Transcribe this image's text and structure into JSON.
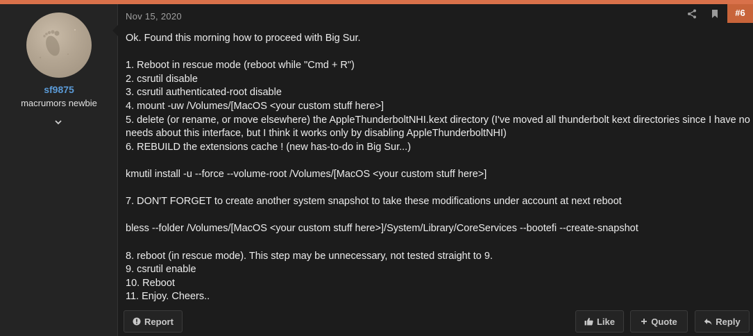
{
  "user": {
    "username": "sf9875",
    "title": "macrumors newbie"
  },
  "post": {
    "date": "Nov 15, 2020",
    "number": "#6",
    "lines": [
      "Ok. Found this morning how to proceed with Big Sur.",
      "",
      "1. Reboot in rescue mode (reboot while \"Cmd + R\")",
      "2. csrutil disable",
      "3. csrutil authenticated-root disable",
      "4. mount -uw /Volumes/[MacOS <your custom stuff here>]",
      "5. delete (or rename, or move elsewhere) the AppleThunderboltNHI.kext directory (I've moved all thunderbolt kext directories since I have no needs about this interface, but I think it works only by disabling AppleThunderboltNHI)",
      "6. REBUILD the extensions cache ! (new has-to-do in Big Sur...)",
      "",
      "kmutil install -u --force --volume-root /Volumes/[MacOS <your custom stuff here>]",
      "",
      "7. DON'T FORGET to create another system snapshot to take these modifications under account at next reboot",
      "",
      "bless --folder /Volumes/[MacOS <your custom stuff here>]/System/Library/CoreServices --bootefi --create-snapshot",
      "",
      "8. reboot (in rescue mode). This step may be unnecessary, not tested straight to 9.",
      "9. csrutil enable",
      "10. Reboot",
      "11. Enjoy. Cheers.."
    ]
  },
  "actions": {
    "report": "Report",
    "like": "Like",
    "quote": "Quote",
    "reply": "Reply"
  },
  "colors": {
    "accent": "#d9714a",
    "username": "#5b9bd8",
    "post_number_bg": "#c8643a"
  },
  "icons": [
    "share-icon",
    "bookmark-icon",
    "chevron-down-icon",
    "alert-icon",
    "thumbs-up-icon",
    "plus-icon",
    "reply-icon"
  ]
}
